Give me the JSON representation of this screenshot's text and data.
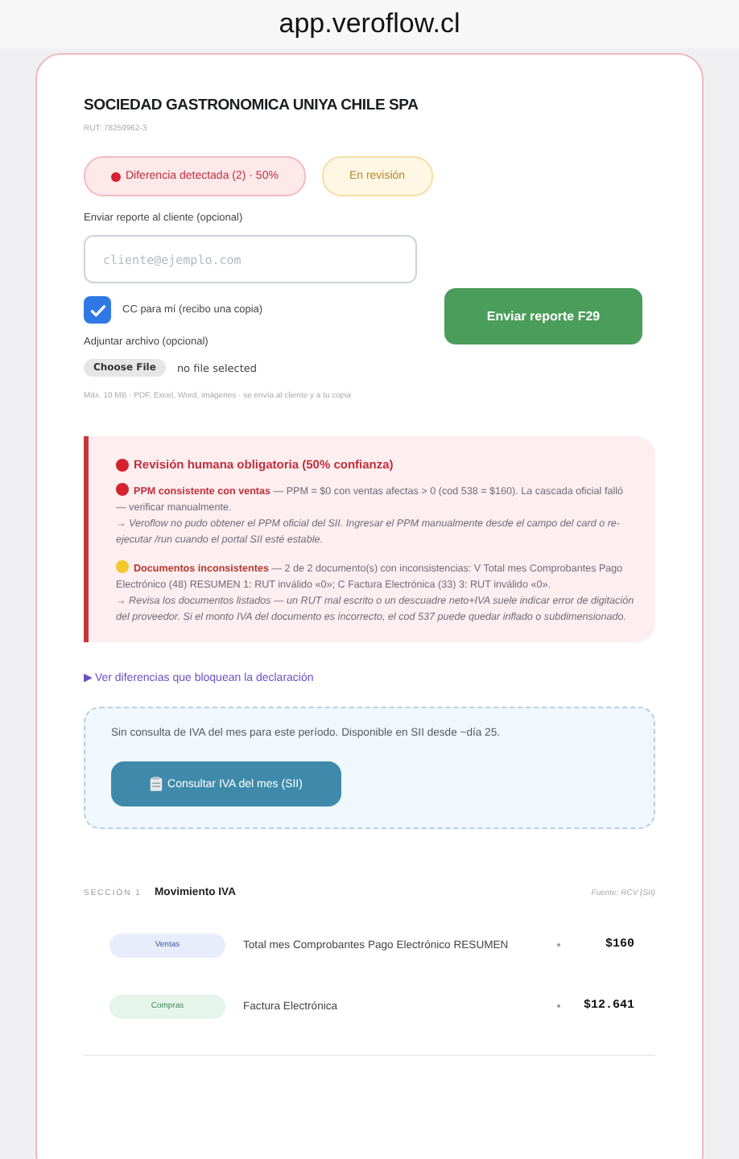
{
  "address_bar": {
    "url": "app.veroflow.cl"
  },
  "company": {
    "name": "SOCIEDAD GASTRONOMICA UNIYA CHILE SPA",
    "rut": "RUT: 78259962-3"
  },
  "status_badges": [
    {
      "kind": "alert",
      "text": "Diferencia detectada (2) · 50%"
    },
    {
      "kind": "pending",
      "text": "En revisión"
    }
  ],
  "report": {
    "label": "Enviar reporte al cliente (opcional)",
    "email": {
      "placeholder": "cliente@ejemplo.com"
    },
    "cc": {
      "label": "CC para mí (recibo una copia)",
      "checked": true
    },
    "send_button": "Enviar reporte F29",
    "attachment": {
      "label": "Adjuntar archivo (opcional)",
      "button": "Choose File",
      "status": "no file selected",
      "hint": "Máx. 10 MB · PDF, Excel, Word, imágenes · se envía al cliente y a tu copia"
    }
  },
  "review_alert": {
    "title": "Revisión humana obligatoria (50% confianza)",
    "items": [
      {
        "kind": "error",
        "text": "**PPM consistente con ventas** — PPM = $0 con ventas afectas > 0 (cod 538 = $160). La cascada oficial falló — verificar manualmente.",
        "advice": "→ Veroflow no pudo obtener el PPM oficial del SII. Ingresar el PPM manualmente desde el campo del card o re-ejecutar /run cuando el portal SII esté estable."
      },
      {
        "kind": "warning",
        "text": "**Documentos inconsistentes** — 2 de 2 documento(s) con inconsistencias: V Total mes Comprobantes Pago Electrónico (48) RESUMEN 1: RUT inválido «0»; C Factura Electrónica (33) 3: RUT inválido «0».",
        "advice": "→ Revisa los documentos listados — un RUT mal escrito o un descuadre neto+IVA suele indicar error de digitación del proveedor. Si el monto IVA del documento es incorrecto, el cod 537 puede quedar inflado o subdimensionado."
      }
    ]
  },
  "blocking_link": {
    "toggle": "▶",
    "label": "Ver diferencias que bloquean la declaración"
  },
  "iva_query": {
    "message": "Sin consulta de IVA del mes para este período. Disponible en SII desde ~día 25.",
    "button": "Consultar IVA del mes (SII)"
  },
  "section": {
    "number": "SECCIÓN 1",
    "title": "Movimiento IVA",
    "source": "Fuente: RCV (SII)",
    "rows": [
      {
        "kind": "ventas",
        "tag": "Ventas",
        "description": "Total mes Comprobantes Pago Electrónico RESUMEN",
        "amount": "$160"
      },
      {
        "kind": "compras",
        "tag": "Compras",
        "description": "Factura Electrónica",
        "amount": "$12.641"
      }
    ]
  }
}
